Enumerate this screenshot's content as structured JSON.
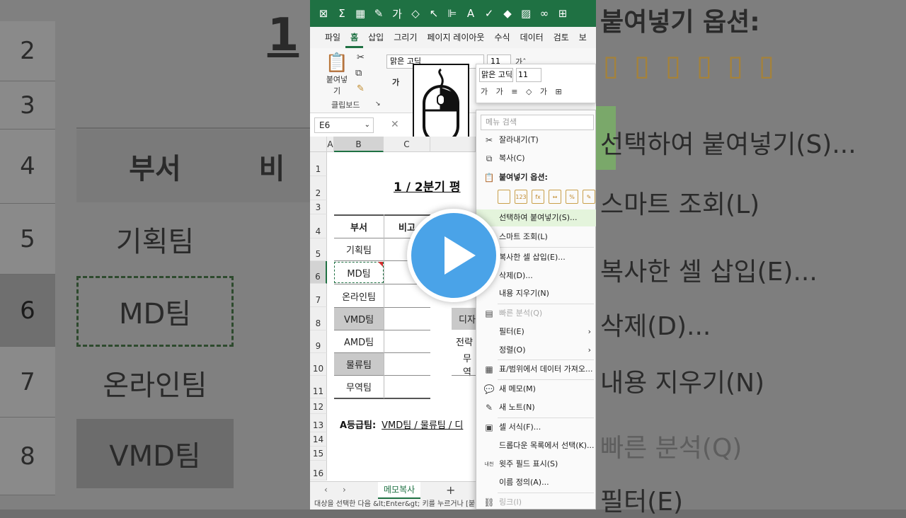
{
  "background_left": {
    "rows": [
      "2",
      "3",
      "4",
      "5",
      "6",
      "7",
      "8"
    ],
    "title_fragment": "1",
    "header_dept": "부서",
    "header_frag": "비",
    "cells": [
      "기획팀",
      "MD팀",
      "온라인팀",
      "VMD팀"
    ]
  },
  "background_right": {
    "items": [
      "붙여넣기 옵션:",
      "선택하여 붙여넣기(S)...",
      "스마트 조회(L)",
      "복사한 셀 삽입(E)...",
      "삭제(D)...",
      "내용 지우기(N)",
      "빠른 분석(Q)",
      "필터(E)"
    ]
  },
  "titlebar": {
    "icons": [
      "excel-icon",
      "sum-icon",
      "table-icon",
      "brush-icon",
      "font-size-icon",
      "shapes-icon",
      "pointer-icon",
      "align-icon",
      "font-color-icon",
      "check-icon",
      "fill-icon",
      "image-icon",
      "link-icon",
      "more-icon"
    ]
  },
  "menubar": {
    "tabs": [
      "파일",
      "홈",
      "삽입",
      "그리기",
      "페이지 레이아웃",
      "수식",
      "데이터",
      "검토",
      "보"
    ],
    "active": "홈"
  },
  "ribbon": {
    "paste_label": "붙여넣기",
    "clipboard_label": "클립보드",
    "font_name": "맑은 고딕",
    "font_size": "11",
    "bold_glyph": "가",
    "grow_glyph": "가ˆ",
    "shrink_glyph": "가ˇ"
  },
  "mini_toolbar": {
    "font": "맑은 고딕",
    "size": "11",
    "row": "가 가 ≡ ◇ 가 ⊞"
  },
  "namebox": "E6",
  "formula_icon": "fx",
  "columns": [
    "A",
    "B",
    "C"
  ],
  "row_numbers": [
    "1",
    "2",
    "3",
    "4",
    "5",
    "6",
    "7",
    "8",
    "9",
    "10",
    "11",
    "12",
    "13",
    "14",
    "15",
    "16"
  ],
  "sheet": {
    "title": "1 / 2분기 평",
    "header_dept": "부서",
    "header_b": "비고",
    "departments": [
      "기획팀",
      "MD팀",
      "온라인팀",
      "VMD팀",
      "AMD팀",
      "물류팀",
      "무역팀"
    ],
    "right_frag": [
      "디자",
      "전략",
      "무역"
    ],
    "grade_label": "A등급팀:",
    "grade_value": "VMD팀 / 물류팀 / 디"
  },
  "sheet_tab": "메모복사",
  "add_sheet": "+",
  "status": "대상을 선택한 다음 &lt;Enter&gt; 키를 누르거나 [붙",
  "context_menu": {
    "search_placeholder": "메뉴 검색",
    "items": [
      {
        "label": "잘라내기(T)",
        "icon": "✂"
      },
      {
        "label": "복사(C)",
        "icon": "⧉"
      },
      {
        "label": "붙여넣기 옵션:",
        "icon": "📋"
      },
      {
        "label": "선택하여 붙여넣기(S)...",
        "icon": ""
      },
      {
        "label": "스마트 조회(L)",
        "icon": "⌕"
      },
      {
        "label": "복사한 셀 삽입(E)...",
        "icon": ""
      },
      {
        "label": "삭제(D)...",
        "icon": ""
      },
      {
        "label": "내용 지우기(N)",
        "icon": ""
      },
      {
        "label": "빠른 분석(Q)",
        "icon": "▤"
      },
      {
        "label": "필터(E)",
        "icon": ""
      },
      {
        "label": "정렬(O)",
        "icon": ""
      },
      {
        "label": "표/범위에서 데이터 가져오...",
        "icon": "▦"
      },
      {
        "label": "새 메모(M)",
        "icon": "💬"
      },
      {
        "label": "새 노트(N)",
        "icon": "✎"
      },
      {
        "label": "셀 서식(F)...",
        "icon": "▣"
      },
      {
        "label": "드롭다운 목록에서 선택(K)...",
        "icon": ""
      },
      {
        "label": "윗주 필드 표시(S)",
        "icon": "내천"
      },
      {
        "label": "이름 정의(A)...",
        "icon": ""
      },
      {
        "label": "링크(I)",
        "icon": "⛓"
      }
    ],
    "paste_icons": [
      "",
      "123",
      "fx",
      "↔",
      "%",
      "✎"
    ]
  },
  "accent": "#1f7143",
  "play_color": "#4aa3e8"
}
